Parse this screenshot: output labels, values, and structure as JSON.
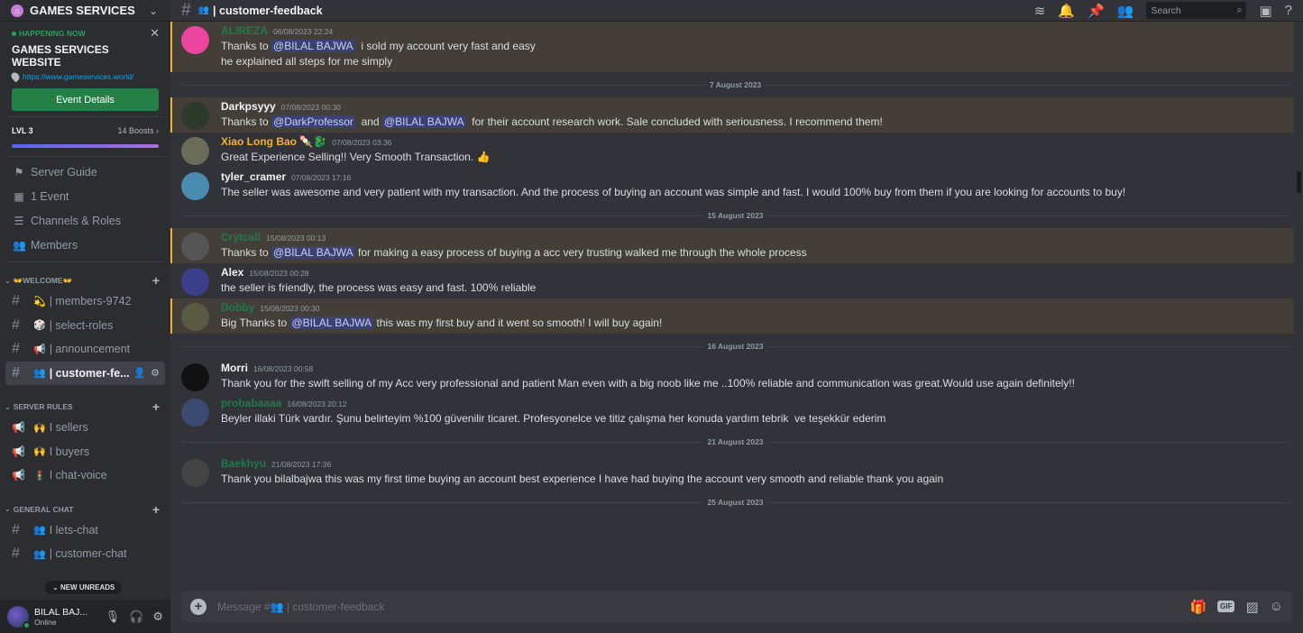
{
  "server": {
    "name": "GAMES SERVICES",
    "event": {
      "status": "HAPPENING NOW",
      "title": "GAMES SERVICES WEBSITE",
      "link": "https://www.gameservices.world/",
      "button": "Event Details"
    },
    "boost": {
      "level": "LVL 3",
      "boosts": "14 Boosts",
      "progress_percent": 100
    }
  },
  "nav": [
    {
      "icon": "signpost-icon",
      "label": "Server Guide"
    },
    {
      "icon": "calendar-icon",
      "label": "1 Event"
    },
    {
      "icon": "channels-icon",
      "label": "Channels & Roles"
    },
    {
      "icon": "members-icon",
      "label": "Members"
    }
  ],
  "categories": [
    {
      "label": "👐WELCOME👐",
      "channels": [
        {
          "type": "text",
          "emoji": "💫",
          "name": "| members-9742"
        },
        {
          "type": "text",
          "emoji": "🎲",
          "name": "| select-roles"
        },
        {
          "type": "text",
          "emoji": "📢",
          "name": "| announcement"
        },
        {
          "type": "text",
          "emoji": "👥",
          "name": "| customer-fe...",
          "active": true
        }
      ]
    },
    {
      "label": "SERVER RULES",
      "channels": [
        {
          "type": "announcement",
          "emoji": "🙌",
          "name": "I sellers"
        },
        {
          "type": "announcement",
          "emoji": "🙌",
          "name": "I buyers"
        },
        {
          "type": "announcement",
          "emoji": "🚦",
          "name": "I chat-voice"
        }
      ]
    },
    {
      "label": "GENERAL CHAT",
      "channels": [
        {
          "type": "text",
          "emoji": "👥",
          "name": "I lets-chat"
        },
        {
          "type": "text",
          "emoji": "👥",
          "name": "| customer-chat"
        }
      ]
    }
  ],
  "new_unreads": "NEW UNREADS",
  "user": {
    "name": "BILAL BAJ...",
    "status": "Online"
  },
  "channel": {
    "title": "| customer-feedback",
    "emoji": "👥"
  },
  "search": {
    "placeholder": "Search"
  },
  "messages": [
    {
      "author": "ALIREZA",
      "color": "#1f7a4c",
      "time": "06/08/2023 22:24",
      "mention": true,
      "avatar": "#eb459f",
      "parts": [
        [
          "t",
          "Thanks to "
        ],
        [
          "m",
          "@BILAL BAJWA"
        ],
        [
          "t",
          "  i sold my account very fast and easy\nhe explained all steps for me simply"
        ]
      ]
    },
    {
      "divider": "7 August 2023"
    },
    {
      "author": "Darkpsyyy",
      "color": "#f2f3f5",
      "time": "07/08/2023 00:30",
      "mention": true,
      "avatar": "#2b3a2a",
      "parts": [
        [
          "t",
          "Thanks to "
        ],
        [
          "m",
          "@DarkProfessor"
        ],
        [
          "t",
          "  and "
        ],
        [
          "m",
          "@BILAL BAJWA"
        ],
        [
          "t",
          "  for their account research work. Sale concluded with seriousness. I recommend them!"
        ]
      ]
    },
    {
      "author": "Xiao Long Bao 🍡🐉",
      "color": "#f0b232",
      "time": "07/08/2023 03:36",
      "mention": false,
      "avatar": "#6b6b5a",
      "parts": [
        [
          "t",
          "Great Experience Selling!! Very Smooth Transaction. 👍"
        ]
      ]
    },
    {
      "author": "tyler_cramer",
      "color": "#f2f3f5",
      "time": "07/08/2023 17:16",
      "mention": false,
      "avatar": "#4a8bb0",
      "parts": [
        [
          "t",
          "The seller was awesome and very patient with my transaction. And the process of buying an account was simple and fast. I would 100% buy from them if you are looking for accounts to buy!"
        ]
      ]
    },
    {
      "divider": "15 August 2023"
    },
    {
      "author": "Crytcall",
      "color": "#1f7a4c",
      "time": "15/08/2023 00:13",
      "mention": true,
      "avatar": "#555",
      "parts": [
        [
          "t",
          "Thanks to "
        ],
        [
          "m",
          "@BILAL BAJWA"
        ],
        [
          "t",
          " for making a easy process of buying a acc very trusting walked me through the whole process"
        ]
      ]
    },
    {
      "author": "Alex",
      "color": "#f2f3f5",
      "time": "15/08/2023 00:28",
      "mention": false,
      "avatar": "#3b3f8a",
      "parts": [
        [
          "t",
          "the seller is friendly, the process was easy and fast. 100% reliable"
        ]
      ]
    },
    {
      "author": "Dobby",
      "color": "#1f7a4c",
      "time": "15/08/2023 00:30",
      "mention": true,
      "avatar": "#5a5a44",
      "parts": [
        [
          "t",
          "Big Thanks to "
        ],
        [
          "m",
          "@BILAL BAJWA"
        ],
        [
          "t",
          " this was my first buy and it went so smooth! I will buy again!"
        ]
      ]
    },
    {
      "divider": "16 August 2023"
    },
    {
      "author": "Morri",
      "color": "#f2f3f5",
      "time": "16/08/2023 00:58",
      "mention": false,
      "avatar": "#111",
      "parts": [
        [
          "t",
          "Thank you for the swift selling of my Acc very professional and patient Man even with a big noob like me ..100% reliable and communication was great.Would use again definitely!!"
        ]
      ]
    },
    {
      "author": "probabaaaa",
      "color": "#1f7a4c",
      "time": "16/08/2023 20:12",
      "mention": false,
      "avatar": "#3a4a70",
      "parts": [
        [
          "t",
          "Beyler illaki Türk vardır. Şunu belirteyim %100 güvenilir ticaret. Profesyonelce ve titiz çalışma her konuda yardım tebrik  ve teşekkür ederim"
        ]
      ]
    },
    {
      "divider": "21 August 2023"
    },
    {
      "author": "Baekhyu",
      "color": "#1f7a4c",
      "time": "21/08/2023 17:36",
      "mention": false,
      "avatar": "#444",
      "parts": [
        [
          "t",
          "Thank you bilalbajwa this was my first time buying an account best experience I have had buying the account very smooth and reliable thank you again"
        ]
      ]
    },
    {
      "divider": "25 August 2023"
    }
  ],
  "composer": {
    "placeholder": "Message #👥 | customer-feedback"
  }
}
